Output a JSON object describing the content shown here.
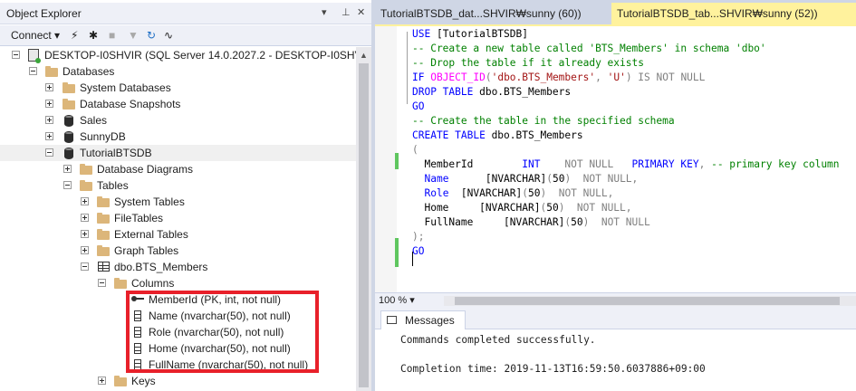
{
  "object_explorer": {
    "title": "Object Explorer",
    "controls": {
      "dropdown": "▾",
      "pin": "ᵖ",
      "close": "✕"
    },
    "toolbar": {
      "connect_label": "Connect"
    },
    "tree": [
      {
        "label": "DESKTOP-I0SHVIR (SQL Server 14.0.2027.2 - DESKTOP-I0SHV",
        "icon": "server-icon",
        "expander": "minus"
      },
      {
        "label": "Databases",
        "icon": "folder-icon",
        "expander": "minus"
      },
      {
        "label": "System Databases",
        "icon": "folder-icon",
        "expander": "plus"
      },
      {
        "label": "Database Snapshots",
        "icon": "folder-icon",
        "expander": "plus"
      },
      {
        "label": "Sales",
        "icon": "database-icon",
        "expander": "plus"
      },
      {
        "label": "SunnyDB",
        "icon": "database-icon",
        "expander": "plus"
      },
      {
        "label": "TutorialBTSDB",
        "icon": "database-icon",
        "expander": "minus"
      },
      {
        "label": "Database Diagrams",
        "icon": "folder-icon",
        "expander": "plus"
      },
      {
        "label": "Tables",
        "icon": "folder-icon",
        "expander": "minus"
      },
      {
        "label": "System Tables",
        "icon": "folder-icon",
        "expander": "plus"
      },
      {
        "label": "FileTables",
        "icon": "folder-icon",
        "expander": "plus"
      },
      {
        "label": "External Tables",
        "icon": "folder-icon",
        "expander": "plus"
      },
      {
        "label": "Graph Tables",
        "icon": "folder-icon",
        "expander": "plus"
      },
      {
        "label": "dbo.BTS_Members",
        "icon": "table-icon",
        "expander": "minus"
      },
      {
        "label": "Columns",
        "icon": "folder-icon",
        "expander": "minus"
      },
      {
        "label": "MemberId (PK, int, not null)",
        "icon": "primary-key-icon",
        "expander": "none"
      },
      {
        "label": "Name (nvarchar(50), not null)",
        "icon": "column-icon",
        "expander": "none"
      },
      {
        "label": "Role (nvarchar(50), not null)",
        "icon": "column-icon",
        "expander": "none"
      },
      {
        "label": "Home (nvarchar(50), not null)",
        "icon": "column-icon",
        "expander": "none"
      },
      {
        "label": "FullName (nvarchar(50), not null)",
        "icon": "column-icon",
        "expander": "none"
      },
      {
        "label": "Keys",
        "icon": "folder-icon",
        "expander": "plus"
      }
    ]
  },
  "tabs": [
    {
      "label": "TutorialBTSDB_dat...SHVIR₩sunny (60))",
      "active": false
    },
    {
      "label": "TutorialBTSDB_tab...SHVIR₩sunny (52))",
      "active": true
    }
  ],
  "editor": {
    "lines": [
      [
        [
          "kw",
          "USE "
        ],
        [
          "tx",
          "[TutorialBTSDB]"
        ]
      ],
      [
        [
          "cm",
          "-- Create a new table called 'BTS_Members' in schema 'dbo'"
        ]
      ],
      [
        [
          "cm",
          "-- Drop the table if it already exists"
        ]
      ],
      [
        [
          "kw",
          "IF "
        ],
        [
          "fn",
          "OBJECT_ID"
        ],
        [
          "gr",
          "("
        ],
        [
          "st",
          "'dbo.BTS_Members'"
        ],
        [
          "gr",
          ", "
        ],
        [
          "st",
          "'U'"
        ],
        [
          "gr",
          ") "
        ],
        [
          "gr",
          "IS NOT NULL"
        ]
      ],
      [
        [
          "kw",
          "DROP TABLE "
        ],
        [
          "tx",
          "dbo.BTS_Members"
        ]
      ],
      [
        [
          "kw",
          "GO"
        ]
      ],
      [
        [
          "cm",
          "-- Create the table in the specified schema"
        ]
      ],
      [
        [
          "kw",
          "CREATE TABLE "
        ],
        [
          "tx",
          "dbo.BTS_Members"
        ]
      ],
      [
        [
          "gr",
          "("
        ]
      ],
      [
        [
          "tx",
          "  MemberId        "
        ],
        [
          "kw",
          "INT    "
        ],
        [
          "gr",
          "NOT NULL   "
        ],
        [
          "kw",
          "PRIMARY KEY"
        ],
        [
          "gr",
          ", "
        ],
        [
          "cm",
          "-- primary key column"
        ]
      ],
      [
        [
          "tx",
          "  "
        ],
        [
          "kw",
          "Name"
        ],
        [
          "tx",
          "      [NVARCHAR]"
        ],
        [
          "gr",
          "("
        ],
        [
          "tx",
          "50"
        ],
        [
          "gr",
          ")  NOT NULL,"
        ]
      ],
      [
        [
          "tx",
          "  "
        ],
        [
          "kw",
          "Role"
        ],
        [
          "tx",
          "  [NVARCHAR]"
        ],
        [
          "gr",
          "("
        ],
        [
          "tx",
          "50"
        ],
        [
          "gr",
          ")  NOT NULL,"
        ]
      ],
      [
        [
          "tx",
          "  Home     [NVARCHAR]"
        ],
        [
          "gr",
          "("
        ],
        [
          "tx",
          "50"
        ],
        [
          "gr",
          ")  NOT NULL,"
        ]
      ],
      [
        [
          "tx",
          "  FullName     [NVARCHAR]"
        ],
        [
          "gr",
          "("
        ],
        [
          "tx",
          "50"
        ],
        [
          "gr",
          ")  NOT NULL"
        ]
      ],
      [
        [
          "gr",
          ");"
        ]
      ],
      [
        [
          "kw",
          "GO"
        ]
      ]
    ]
  },
  "status": {
    "zoom": "100 %"
  },
  "messages": {
    "tab_label": "Messages",
    "lines": [
      "Commands completed successfully.",
      "Completion time: 2019-11-13T16:59:50.6037886+09:00"
    ]
  },
  "colors": {
    "highlight_border": "#e8202a",
    "active_tab": "#fff29d",
    "change_margin": "#5fc65f"
  }
}
